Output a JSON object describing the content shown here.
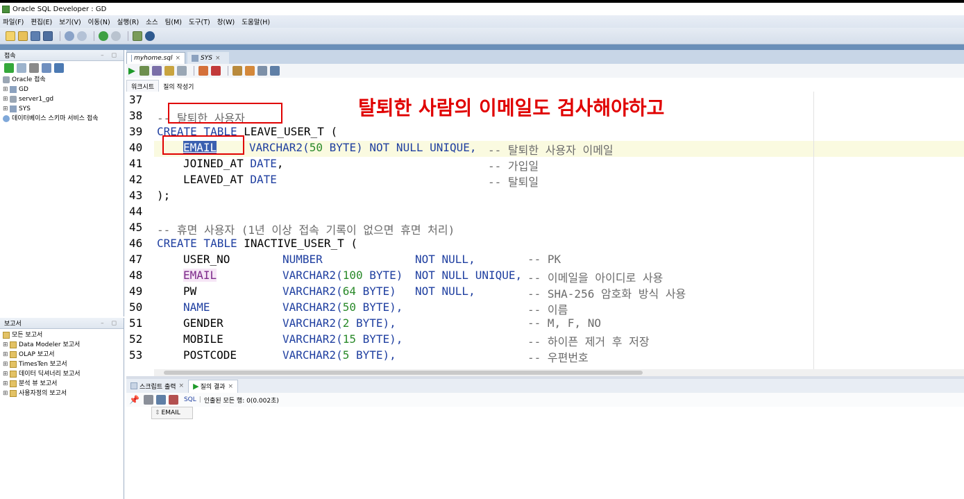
{
  "window": {
    "title": "Oracle SQL Developer : GD"
  },
  "menu": [
    "파일(F)",
    "편집(E)",
    "보기(V)",
    "이동(N)",
    "실행(R)",
    "소스",
    "팀(M)",
    "도구(T)",
    "창(W)",
    "도움말(H)"
  ],
  "connections_panel": {
    "title": "접속",
    "items": [
      {
        "label": "Oracle 접속"
      },
      {
        "label": "GD"
      },
      {
        "label": "server1_gd"
      },
      {
        "label": "SYS"
      },
      {
        "label": "데이터베이스 스키마 서비스 접속"
      }
    ]
  },
  "reports_panel": {
    "title": "보고서",
    "items": [
      {
        "label": "모든 보고서"
      },
      {
        "label": "Data Modeler 보고서"
      },
      {
        "label": "OLAP 보고서"
      },
      {
        "label": "TimesTen 보고서"
      },
      {
        "label": "데이터 딕셔너리 보고서"
      },
      {
        "label": "분석 뷰 보고서"
      },
      {
        "label": "사용자정의 보고서"
      }
    ]
  },
  "editor": {
    "tabs": [
      {
        "label": "myhome.sql"
      },
      {
        "label": "SYS"
      }
    ],
    "subtabs": [
      "워크시트",
      "질의 작성기"
    ],
    "line_numbers": [
      "37",
      "38",
      "39",
      "40",
      "41",
      "42",
      "43",
      "44",
      "45",
      "46",
      "47",
      "48",
      "49",
      "50",
      "51",
      "52",
      "53"
    ],
    "lines": {
      "l38_comment": "-- 탈퇴한 사용자",
      "l39_create": "CREATE TABLE",
      "l39_name": " LEAVE_USER_T (",
      "l40_col": "EMAIL",
      "l40_type": "VARCHAR2(",
      "l40_num": "50",
      "l40_type2": " BYTE) NOT NULL UNIQUE,",
      "l40_comment": "-- 탈퇴한 사용자 이메일",
      "l41_col": "JOINED_AT",
      "l41_type": "DATE",
      "l41_comma": ",",
      "l41_comment": "-- 가입일",
      "l42_col": "LEAVED_AT",
      "l42_type": "DATE",
      "l42_comment": "-- 탈퇴일",
      "l43": ");",
      "l45_comment": "-- 휴면 사용자 (1년 이상 접속 기록이 없으면 휴면 처리)",
      "l46_create": "CREATE TABLE",
      "l46_name": " INACTIVE_USER_T (",
      "l47_col": "USER_NO",
      "l47_type": "NUMBER",
      "l47_null": "NOT NULL,",
      "l47_comment": "-- PK",
      "l48_col": "EMAIL",
      "l48_type": "VARCHAR2(",
      "l48_num": "100",
      "l48_type2": " BYTE)",
      "l48_null": "NOT NULL UNIQUE,",
      "l48_comment": "-- 이메일을 아이디로 사용",
      "l49_col": "PW",
      "l49_type": "VARCHAR2(",
      "l49_num": "64",
      "l49_type2": " BYTE)",
      "l49_null": "NOT NULL,",
      "l49_comment": "-- SHA-256 암호화 방식 사용",
      "l50_col": "NAME",
      "l50_type": "VARCHAR2(",
      "l50_num": "50",
      "l50_type2": " BYTE),",
      "l50_comment": "-- 이름",
      "l51_col": "GENDER",
      "l51_type": "VARCHAR2(",
      "l51_num": "2",
      "l51_type2": " BYTE),",
      "l51_comment": "-- M, F, NO",
      "l52_col": "MOBILE",
      "l52_type": "VARCHAR2(",
      "l52_num": "15",
      "l52_type2": " BYTE),",
      "l52_comment": "-- 하이픈 제거 후 저장",
      "l53_col": "POSTCODE",
      "l53_type": "VARCHAR2(",
      "l53_num": "5",
      "l53_type2": " BYTE),",
      "l53_comment": "-- 우편번호"
    }
  },
  "annotation": "탈퇴한 사람의 이메일도 검사해야하고",
  "output": {
    "tabs": [
      "스크립트 출력",
      "질의 결과"
    ],
    "toolbar_sql": "SQL",
    "toolbar_status": "인출된 모든 행: 0(0.002초)",
    "column_header": "EMAIL"
  },
  "colors": {
    "annotation": "#e00000",
    "keyword": "#1f3fa0",
    "comment": "#6b6b6b",
    "number": "#2a8a2a"
  }
}
